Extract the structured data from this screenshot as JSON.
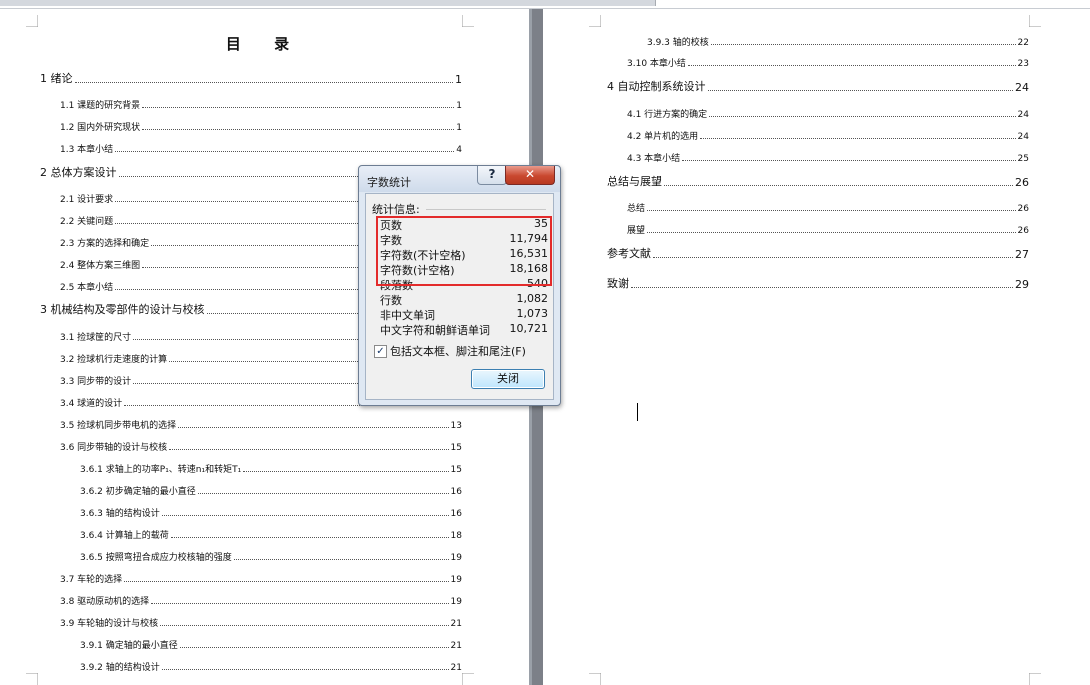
{
  "document": {
    "toc_heading": "目 录",
    "left_entries": [
      {
        "label": "1  绪论",
        "page": "1",
        "level": 1
      },
      {
        "label": "1.1 课题的研究背景",
        "page": "1",
        "level": 2
      },
      {
        "label": "1.2 国内外研究现状",
        "page": "1",
        "level": 2
      },
      {
        "label": "1.3 本章小结",
        "page": "4",
        "level": 2
      },
      {
        "label": "2  总体方案设计",
        "page": "",
        "level": 1
      },
      {
        "label": "2.1 设计要求",
        "page": "",
        "level": 2
      },
      {
        "label": "2.2 关键问题",
        "page": "",
        "level": 2
      },
      {
        "label": "2.3 方案的选择和确定",
        "page": "",
        "level": 2
      },
      {
        "label": "2.4 整体方案三维图",
        "page": "",
        "level": 2
      },
      {
        "label": "2.5 本章小结",
        "page": "",
        "level": 2
      },
      {
        "label": "3  机械结构及零部件的设计与校核",
        "page": "",
        "level": 1
      },
      {
        "label": "3.1 捡球筐的尺寸",
        "page": "",
        "level": 2
      },
      {
        "label": "3.2 捡球机行走速度的计算",
        "page": "",
        "level": 2
      },
      {
        "label": "3.3 同步带的设计",
        "page": "",
        "level": 2
      },
      {
        "label": "3.4 球道的设计",
        "page": "",
        "level": 2
      },
      {
        "label": "3.5 捡球机同步带电机的选择",
        "page": "13",
        "level": 2
      },
      {
        "label": "3.6 同步带轴的设计与校核",
        "page": "15",
        "level": 2
      },
      {
        "label": "3.6.1 求轴上的功率P₁、转速n₁和转矩T₁",
        "page": "15",
        "level": 3
      },
      {
        "label": "3.6.2 初步确定轴的最小直径",
        "page": "16",
        "level": 3
      },
      {
        "label": "3.6.3 轴的结构设计",
        "page": "16",
        "level": 3
      },
      {
        "label": "3.6.4 计算轴上的载荷",
        "page": "18",
        "level": 3
      },
      {
        "label": "3.6.5 按照弯扭合成应力校核轴的强度",
        "page": "19",
        "level": 3
      },
      {
        "label": "3.7 车轮的选择",
        "page": "19",
        "level": 2
      },
      {
        "label": "3.8 驱动原动机的选择",
        "page": "19",
        "level": 2
      },
      {
        "label": "3.9 车轮轴的设计与校核",
        "page": "21",
        "level": 2
      },
      {
        "label": "3.9.1 确定轴的最小直径",
        "page": "21",
        "level": 3
      },
      {
        "label": "3.9.2 轴的结构设计",
        "page": "21",
        "level": 3
      }
    ],
    "right_entries": [
      {
        "label": "3.9.3 轴的校核",
        "page": "22",
        "level": 3
      },
      {
        "label": "3.10 本章小结",
        "page": "23",
        "level": 2
      },
      {
        "label": "4  自动控制系统设计",
        "page": "24",
        "level": 1
      },
      {
        "label": "4.1 行进方案的确定",
        "page": "24",
        "level": 2
      },
      {
        "label": "4.2 单片机的选用",
        "page": "24",
        "level": 2
      },
      {
        "label": "4.3 本章小结",
        "page": "25",
        "level": 2
      },
      {
        "label": "总结与展望",
        "page": "26",
        "level": 1
      },
      {
        "label": "总结",
        "page": "26",
        "level": 2
      },
      {
        "label": "展望",
        "page": "26",
        "level": 2
      },
      {
        "label": "参考文献",
        "page": "27",
        "level": 1
      },
      {
        "label": "致谢",
        "page": "29",
        "level": 1
      }
    ]
  },
  "dialog": {
    "title": "字数统计",
    "help_label": "?",
    "close_x_label": "✕",
    "group_label": "统计信息:",
    "stats": [
      {
        "name": "页数",
        "value": "35"
      },
      {
        "name": "字数",
        "value": "11,794"
      },
      {
        "name": "字符数(不计空格)",
        "value": "16,531"
      },
      {
        "name": "字符数(计空格)",
        "value": "18,168"
      },
      {
        "name": "段落数",
        "value": "540"
      },
      {
        "name": "行数",
        "value": "1,082"
      },
      {
        "name": "非中文单词",
        "value": "1,073"
      },
      {
        "name": "中文字符和朝鲜语单词",
        "value": "10,721"
      }
    ],
    "checkbox_label": "包括文本框、脚注和尾注(F)",
    "checkbox_checked": true,
    "close_button_label": "关闭",
    "highlight_color": "#e32b2b"
  }
}
